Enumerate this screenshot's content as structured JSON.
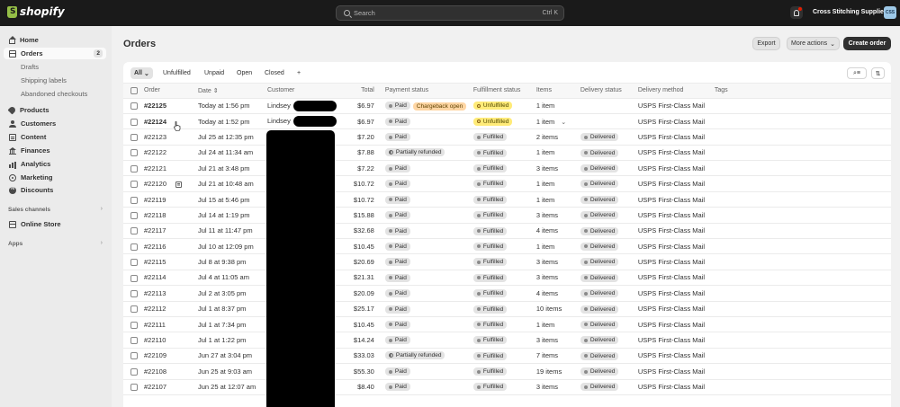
{
  "topbar": {
    "logo_text": "shopify",
    "search_placeholder": "Search",
    "search_shortcut": "Ctrl K",
    "store_name": "Cross Stitching Supplies",
    "store_initials": "CSS",
    "icons": [
      "shopify-logo-icon",
      "search-icon",
      "bell-icon"
    ]
  },
  "sidebar": {
    "items": [
      {
        "label": "Home",
        "icon": "home-icon"
      },
      {
        "label": "Orders",
        "icon": "orders-icon",
        "badge": "2"
      },
      {
        "label": "Products",
        "icon": "tag-icon"
      },
      {
        "label": "Customers",
        "icon": "person-icon"
      },
      {
        "label": "Content",
        "icon": "content-icon"
      },
      {
        "label": "Finances",
        "icon": "bank-icon"
      },
      {
        "label": "Analytics",
        "icon": "chart-icon"
      },
      {
        "label": "Marketing",
        "icon": "target-icon"
      },
      {
        "label": "Discounts",
        "icon": "discount-icon"
      }
    ],
    "order_subitems": [
      "Drafts",
      "Shipping labels",
      "Abandoned checkouts"
    ],
    "sales_channels_label": "Sales channels",
    "online_store_label": "Online Store",
    "apps_label": "Apps"
  },
  "header": {
    "title": "Orders",
    "export_label": "Export",
    "more_actions_label": "More actions",
    "create_order_label": "Create order"
  },
  "tabs": [
    "All",
    "Unfulfilled",
    "Unpaid",
    "Open",
    "Closed",
    "+"
  ],
  "columns": [
    "Order",
    "Date",
    "Customer",
    "Total",
    "Payment status",
    "Fulfillment status",
    "Items",
    "Delivery status",
    "Delivery method",
    "Tags"
  ],
  "orders": [
    {
      "order": "#22125",
      "date": "Today at 1:56 pm",
      "customer": "Lindsey",
      "total": "$6.97",
      "payment": "Paid",
      "payment_extra": "Chargeback open",
      "fulfillment": "Unfulfilled",
      "items": "1 item",
      "delivery": "",
      "method": "USPS First-Class Mail"
    },
    {
      "order": "#22124",
      "date": "Today at 1:52 pm",
      "customer": "Lindsey",
      "total": "$6.97",
      "payment": "Paid",
      "payment_extra": "",
      "fulfillment": "Unfulfilled",
      "items": "1 item",
      "delivery": "",
      "method": "USPS First-Class Mail"
    },
    {
      "order": "#22123",
      "date": "Jul 25 at 12:35 pm",
      "customer": "",
      "total": "$7.20",
      "payment": "Paid",
      "payment_extra": "",
      "fulfillment": "Fulfilled",
      "items": "2 items",
      "delivery": "Delivered",
      "method": "USPS First-Class Mail"
    },
    {
      "order": "#22122",
      "date": "Jul 24 at 11:34 am",
      "customer": "",
      "total": "$7.88",
      "payment": "Partially refunded",
      "payment_extra": "",
      "fulfillment": "Fulfilled",
      "items": "1 item",
      "delivery": "Delivered",
      "method": "USPS First-Class Mail"
    },
    {
      "order": "#22121",
      "date": "Jul 21 at 3:48 pm",
      "customer": "",
      "total": "$7.22",
      "payment": "Paid",
      "payment_extra": "",
      "fulfillment": "Fulfilled",
      "items": "3 items",
      "delivery": "Delivered",
      "method": "USPS First-Class Mail"
    },
    {
      "order": "#22120",
      "date": "Jul 21 at 10:48 am",
      "customer": "",
      "total": "$10.72",
      "payment": "Paid",
      "payment_extra": "",
      "fulfillment": "Fulfilled",
      "items": "1 item",
      "delivery": "Delivered",
      "method": "USPS First-Class Mail"
    },
    {
      "order": "#22119",
      "date": "Jul 15 at 5:46 pm",
      "customer": "",
      "total": "$10.72",
      "payment": "Paid",
      "payment_extra": "",
      "fulfillment": "Fulfilled",
      "items": "1 item",
      "delivery": "Delivered",
      "method": "USPS First-Class Mail"
    },
    {
      "order": "#22118",
      "date": "Jul 14 at 1:19 pm",
      "customer": "",
      "total": "$15.88",
      "payment": "Paid",
      "payment_extra": "",
      "fulfillment": "Fulfilled",
      "items": "3 items",
      "delivery": "Delivered",
      "method": "USPS First-Class Mail"
    },
    {
      "order": "#22117",
      "date": "Jul 11 at 11:47 pm",
      "customer": "",
      "total": "$32.68",
      "payment": "Paid",
      "payment_extra": "",
      "fulfillment": "Fulfilled",
      "items": "4 items",
      "delivery": "Delivered",
      "method": "USPS First-Class Mail"
    },
    {
      "order": "#22116",
      "date": "Jul 10 at 12:09 pm",
      "customer": "",
      "total": "$10.45",
      "payment": "Paid",
      "payment_extra": "",
      "fulfillment": "Fulfilled",
      "items": "1 item",
      "delivery": "Delivered",
      "method": "USPS First-Class Mail"
    },
    {
      "order": "#22115",
      "date": "Jul 8 at 9:38 pm",
      "customer": "",
      "total": "$20.69",
      "payment": "Paid",
      "payment_extra": "",
      "fulfillment": "Fulfilled",
      "items": "3 items",
      "delivery": "Delivered",
      "method": "USPS First-Class Mail"
    },
    {
      "order": "#22114",
      "date": "Jul 4 at 11:05 am",
      "customer": "",
      "total": "$21.31",
      "payment": "Paid",
      "payment_extra": "",
      "fulfillment": "Fulfilled",
      "items": "3 items",
      "delivery": "Delivered",
      "method": "USPS First-Class Mail"
    },
    {
      "order": "#22113",
      "date": "Jul 2 at 3:05 pm",
      "customer": "",
      "total": "$20.09",
      "payment": "Paid",
      "payment_extra": "",
      "fulfillment": "Fulfilled",
      "items": "4 items",
      "delivery": "Delivered",
      "method": "USPS First-Class Mail"
    },
    {
      "order": "#22112",
      "date": "Jul 1 at 8:37 pm",
      "customer": "",
      "total": "$25.17",
      "payment": "Paid",
      "payment_extra": "",
      "fulfillment": "Fulfilled",
      "items": "10 items",
      "delivery": "Delivered",
      "method": "USPS First-Class Mail"
    },
    {
      "order": "#22111",
      "date": "Jul 1 at 7:34 pm",
      "customer": "",
      "total": "$10.45",
      "payment": "Paid",
      "payment_extra": "",
      "fulfillment": "Fulfilled",
      "items": "1 item",
      "delivery": "Delivered",
      "method": "USPS First-Class Mail"
    },
    {
      "order": "#22110",
      "date": "Jul 1 at 1:22 pm",
      "customer": "",
      "total": "$14.24",
      "payment": "Paid",
      "payment_extra": "",
      "fulfillment": "Fulfilled",
      "items": "3 items",
      "delivery": "Delivered",
      "method": "USPS First-Class Mail"
    },
    {
      "order": "#22109",
      "date": "Jun 27 at 3:04 pm",
      "customer": "",
      "total": "$33.03",
      "payment": "Partially refunded",
      "payment_extra": "",
      "fulfillment": "Fulfilled",
      "items": "7 items",
      "delivery": "Delivered",
      "method": "USPS First-Class Mail"
    },
    {
      "order": "#22108",
      "date": "Jun 25 at 9:03 am",
      "customer": "",
      "total": "$55.30",
      "payment": "Paid",
      "payment_extra": "",
      "fulfillment": "Fulfilled",
      "items": "19 items",
      "delivery": "Delivered",
      "method": "USPS First-Class Mail"
    },
    {
      "order": "#22107",
      "date": "Jun 25 at 12:07 am",
      "customer": "",
      "total": "$8.40",
      "payment": "Paid",
      "payment_extra": "",
      "fulfillment": "Fulfilled",
      "items": "3 items",
      "delivery": "Delivered",
      "method": "USPS First-Class Mail"
    }
  ]
}
